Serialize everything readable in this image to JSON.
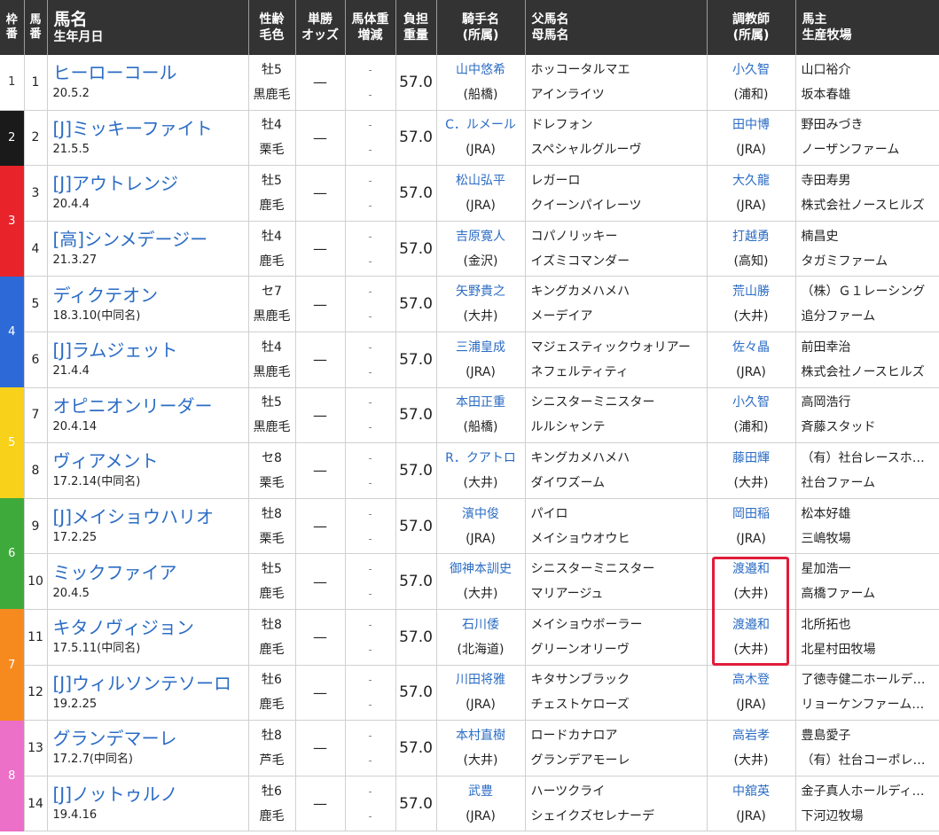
{
  "header": {
    "waku": "枠\n番",
    "uma": "馬\n番",
    "name_main": "馬名",
    "name_sub": "生年月日",
    "sex_age": "性齢",
    "coat": "毛色",
    "odds1": "単勝",
    "odds2": "オッズ",
    "weight1": "馬体重",
    "weight2": "増減",
    "kin1": "負担",
    "kin2": "重量",
    "jockey1": "騎手名",
    "jockey2": "(所属)",
    "sire1": "父馬名",
    "sire2": "母馬名",
    "trainer1": "調教師",
    "trainer2": "(所属)",
    "owner1": "馬主",
    "owner2": "生産牧場"
  },
  "waku": [
    {
      "num": "1",
      "rows": 1,
      "color": "#ffffff"
    },
    {
      "num": "2",
      "rows": 1,
      "color": "#1a1a1a"
    },
    {
      "num": "3",
      "rows": 2,
      "color": "#e8232a"
    },
    {
      "num": "4",
      "rows": 2,
      "color": "#2d6ad8"
    },
    {
      "num": "5",
      "rows": 2,
      "color": "#f7d11a"
    },
    {
      "num": "6",
      "rows": 2,
      "color": "#3daa3b"
    },
    {
      "num": "7",
      "rows": 2,
      "color": "#f78a1f"
    },
    {
      "num": "8",
      "rows": 2,
      "color": "#ec6fc8"
    }
  ],
  "rows": [
    {
      "uma": "1",
      "name": "ヒーローコール",
      "birth": "20.5.2",
      "sex": "牡5",
      "coat": "黒鹿毛",
      "odds": "—",
      "w1": "-",
      "w2": "-",
      "kin": "57.0",
      "jockey": "山中悠希",
      "jaff": "(船橋)",
      "sire": "ホッコータルマエ",
      "dam": "アインライツ",
      "trainer": "小久智",
      "taff": "(浦和)",
      "owner": "山口裕介",
      "breeder": "坂本春雄"
    },
    {
      "uma": "2",
      "name": "[J]ミッキーファイト",
      "birth": "21.5.5",
      "sex": "牡4",
      "coat": "栗毛",
      "odds": "—",
      "w1": "-",
      "w2": "-",
      "kin": "57.0",
      "jockey": "C．ルメール",
      "jaff": "(JRA)",
      "sire": "ドレフォン",
      "dam": "スペシャルグルーヴ",
      "trainer": "田中博",
      "taff": "(JRA)",
      "owner": "野田みづき",
      "breeder": "ノーザンファーム"
    },
    {
      "uma": "3",
      "name": "[J]アウトレンジ",
      "birth": "20.4.4",
      "sex": "牡5",
      "coat": "鹿毛",
      "odds": "—",
      "w1": "-",
      "w2": "-",
      "kin": "57.0",
      "jockey": "松山弘平",
      "jaff": "(JRA)",
      "sire": "レガーロ",
      "dam": "クイーンパイレーツ",
      "trainer": "大久龍",
      "taff": "(JRA)",
      "owner": "寺田寿男",
      "breeder": "株式会社ノースヒルズ"
    },
    {
      "uma": "4",
      "name": "[高]シンメデージー",
      "birth": "21.3.27",
      "sex": "牡4",
      "coat": "鹿毛",
      "odds": "—",
      "w1": "-",
      "w2": "-",
      "kin": "57.0",
      "jockey": "吉原寛人",
      "jaff": "(金沢)",
      "sire": "コパノリッキー",
      "dam": "イズミコマンダー",
      "trainer": "打越勇",
      "taff": "(高知)",
      "owner": "楠昌史",
      "breeder": "タガミファーム"
    },
    {
      "uma": "5",
      "name": "ディクテオン",
      "birth": "18.3.10(中同名)",
      "sex": "セ7",
      "coat": "黒鹿毛",
      "odds": "—",
      "w1": "-",
      "w2": "-",
      "kin": "57.0",
      "jockey": "矢野貴之",
      "jaff": "(大井)",
      "sire": "キングカメハメハ",
      "dam": "メーデイア",
      "trainer": "荒山勝",
      "taff": "(大井)",
      "owner": "（株）Ｇ１レーシング",
      "breeder": "追分ファーム"
    },
    {
      "uma": "6",
      "name": "[J]ラムジェット",
      "birth": "21.4.4",
      "sex": "牡4",
      "coat": "黒鹿毛",
      "odds": "—",
      "w1": "-",
      "w2": "-",
      "kin": "57.0",
      "jockey": "三浦皇成",
      "jaff": "(JRA)",
      "sire": "マジェスティックウォリアー",
      "dam": "ネフェルティティ",
      "trainer": "佐々晶",
      "taff": "(JRA)",
      "owner": "前田幸治",
      "breeder": "株式会社ノースヒルズ"
    },
    {
      "uma": "7",
      "name": "オピニオンリーダー",
      "birth": "20.4.14",
      "sex": "牡5",
      "coat": "黒鹿毛",
      "odds": "—",
      "w1": "-",
      "w2": "-",
      "kin": "57.0",
      "jockey": "本田正重",
      "jaff": "(船橋)",
      "sire": "シニスターミニスター",
      "dam": "ルルシャンテ",
      "trainer": "小久智",
      "taff": "(浦和)",
      "owner": "高岡浩行",
      "breeder": "斉藤スタッド"
    },
    {
      "uma": "8",
      "name": "ヴィアメント",
      "birth": "17.2.14(中同名)",
      "sex": "セ8",
      "coat": "栗毛",
      "odds": "—",
      "w1": "-",
      "w2": "-",
      "kin": "57.0",
      "jockey": "R．クアトロ",
      "jaff": "(大井)",
      "sire": "キングカメハメハ",
      "dam": "ダイワズーム",
      "trainer": "藤田輝",
      "taff": "(大井)",
      "owner": "（有）社台レースホ…",
      "breeder": "社台ファーム"
    },
    {
      "uma": "9",
      "name": "[J]メイショウハリオ",
      "birth": "17.2.25",
      "sex": "牡8",
      "coat": "栗毛",
      "odds": "—",
      "w1": "-",
      "w2": "-",
      "kin": "57.0",
      "jockey": "濱中俊",
      "jaff": "(JRA)",
      "sire": "パイロ",
      "dam": "メイショウオウヒ",
      "trainer": "岡田稲",
      "taff": "(JRA)",
      "owner": "松本好雄",
      "breeder": "三嶋牧場"
    },
    {
      "uma": "10",
      "name": "ミックファイア",
      "birth": "20.4.5",
      "sex": "牡5",
      "coat": "鹿毛",
      "odds": "—",
      "w1": "-",
      "w2": "-",
      "kin": "57.0",
      "jockey": "御神本訓史",
      "jaff": "(大井)",
      "sire": "シニスターミニスター",
      "dam": "マリアージュ",
      "trainer": "渡邉和",
      "taff": "(大井)",
      "owner": "星加浩一",
      "breeder": "高橋ファーム"
    },
    {
      "uma": "11",
      "name": "キタノヴィジョン",
      "birth": "17.5.11(中同名)",
      "sex": "牡8",
      "coat": "鹿毛",
      "odds": "—",
      "w1": "-",
      "w2": "-",
      "kin": "57.0",
      "jockey": "石川倭",
      "jaff": "(北海道)",
      "sire": "メイショウボーラー",
      "dam": "グリーンオリーヴ",
      "trainer": "渡邉和",
      "taff": "(大井)",
      "owner": "北所拓也",
      "breeder": "北星村田牧場"
    },
    {
      "uma": "12",
      "name": "[J]ウィルソンテソーロ",
      "birth": "19.2.25",
      "sex": "牡6",
      "coat": "鹿毛",
      "odds": "—",
      "w1": "-",
      "w2": "-",
      "kin": "57.0",
      "jockey": "川田将雅",
      "jaff": "(JRA)",
      "sire": "キタサンブラック",
      "dam": "チェストケローズ",
      "trainer": "高木登",
      "taff": "(JRA)",
      "owner": "了徳寺健二ホールデ…",
      "breeder": "リョーケンファーム…"
    },
    {
      "uma": "13",
      "name": "グランデマーレ",
      "birth": "17.2.7(中同名)",
      "sex": "牡8",
      "coat": "芦毛",
      "odds": "—",
      "w1": "-",
      "w2": "-",
      "kin": "57.0",
      "jockey": "本村直樹",
      "jaff": "(大井)",
      "sire": "ロードカナロア",
      "dam": "グランデアモーレ",
      "trainer": "高岩孝",
      "taff": "(大井)",
      "owner": "豊島愛子",
      "breeder": "（有）社台コーポレ…"
    },
    {
      "uma": "14",
      "name": "[J]ノットゥルノ",
      "birth": "19.4.16",
      "sex": "牡6",
      "coat": "鹿毛",
      "odds": "—",
      "w1": "-",
      "w2": "-",
      "kin": "57.0",
      "jockey": "武豊",
      "jaff": "(JRA)",
      "sire": "ハーツクライ",
      "dam": "シェイクズセレナーデ",
      "trainer": "中舘英",
      "taff": "(JRA)",
      "owner": "金子真人ホールディ…",
      "breeder": "下河辺牧場"
    }
  ]
}
